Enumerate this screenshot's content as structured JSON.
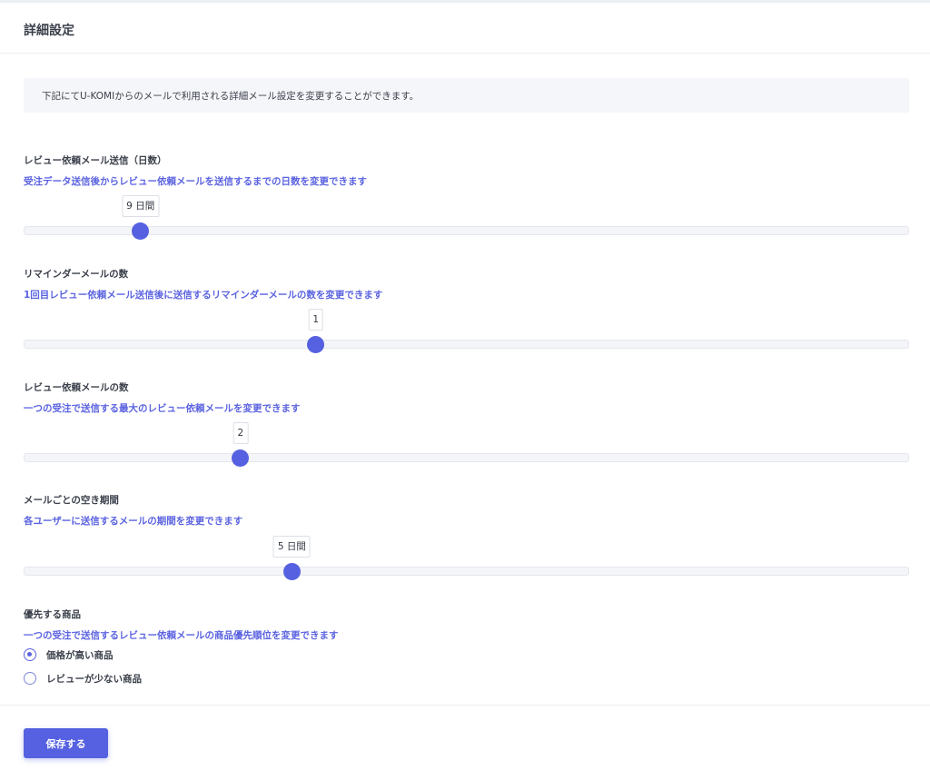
{
  "header": {
    "title": "詳細設定"
  },
  "info": {
    "text": "下記にてU-KOMIからのメールで利用される詳細メール設定を変更することができます。"
  },
  "settings": [
    {
      "label": "レビュー依頼メール送信（日数）",
      "description": "受注データ送信後からレビュー依頼メールを送信するまでの日数を変更できます",
      "value_label": "9 日間",
      "level": 0.132
    },
    {
      "label": "リマインダーメールの数",
      "description": "1回目レビュー依頼メール送信後に送信するリマインダーメールの数を変更できます",
      "value_label": "1",
      "level": 0.33
    },
    {
      "label": "レビュー依頼メールの数",
      "description": "一つの受注で送信する最大のレビュー依頼メールを変更できます",
      "value_label": "2",
      "level": 0.245
    },
    {
      "label": "メールごとの空き期間",
      "description": "各ユーザーに送信するメールの期間を変更できます",
      "value_label": "5 日間",
      "level": 0.303
    }
  ],
  "priority": {
    "label": "優先する商品",
    "description": "一つの受注で送信するレビュー依頼メールの商品優先順位を変更できます",
    "options": [
      {
        "label": "価格が高い商品",
        "selected": true
      },
      {
        "label": "レビューが少ない商品",
        "selected": false
      }
    ]
  },
  "footer": {
    "save_label": "保存する"
  },
  "colors": {
    "accent": "#5561e0",
    "description_text": "#5b63e0"
  }
}
